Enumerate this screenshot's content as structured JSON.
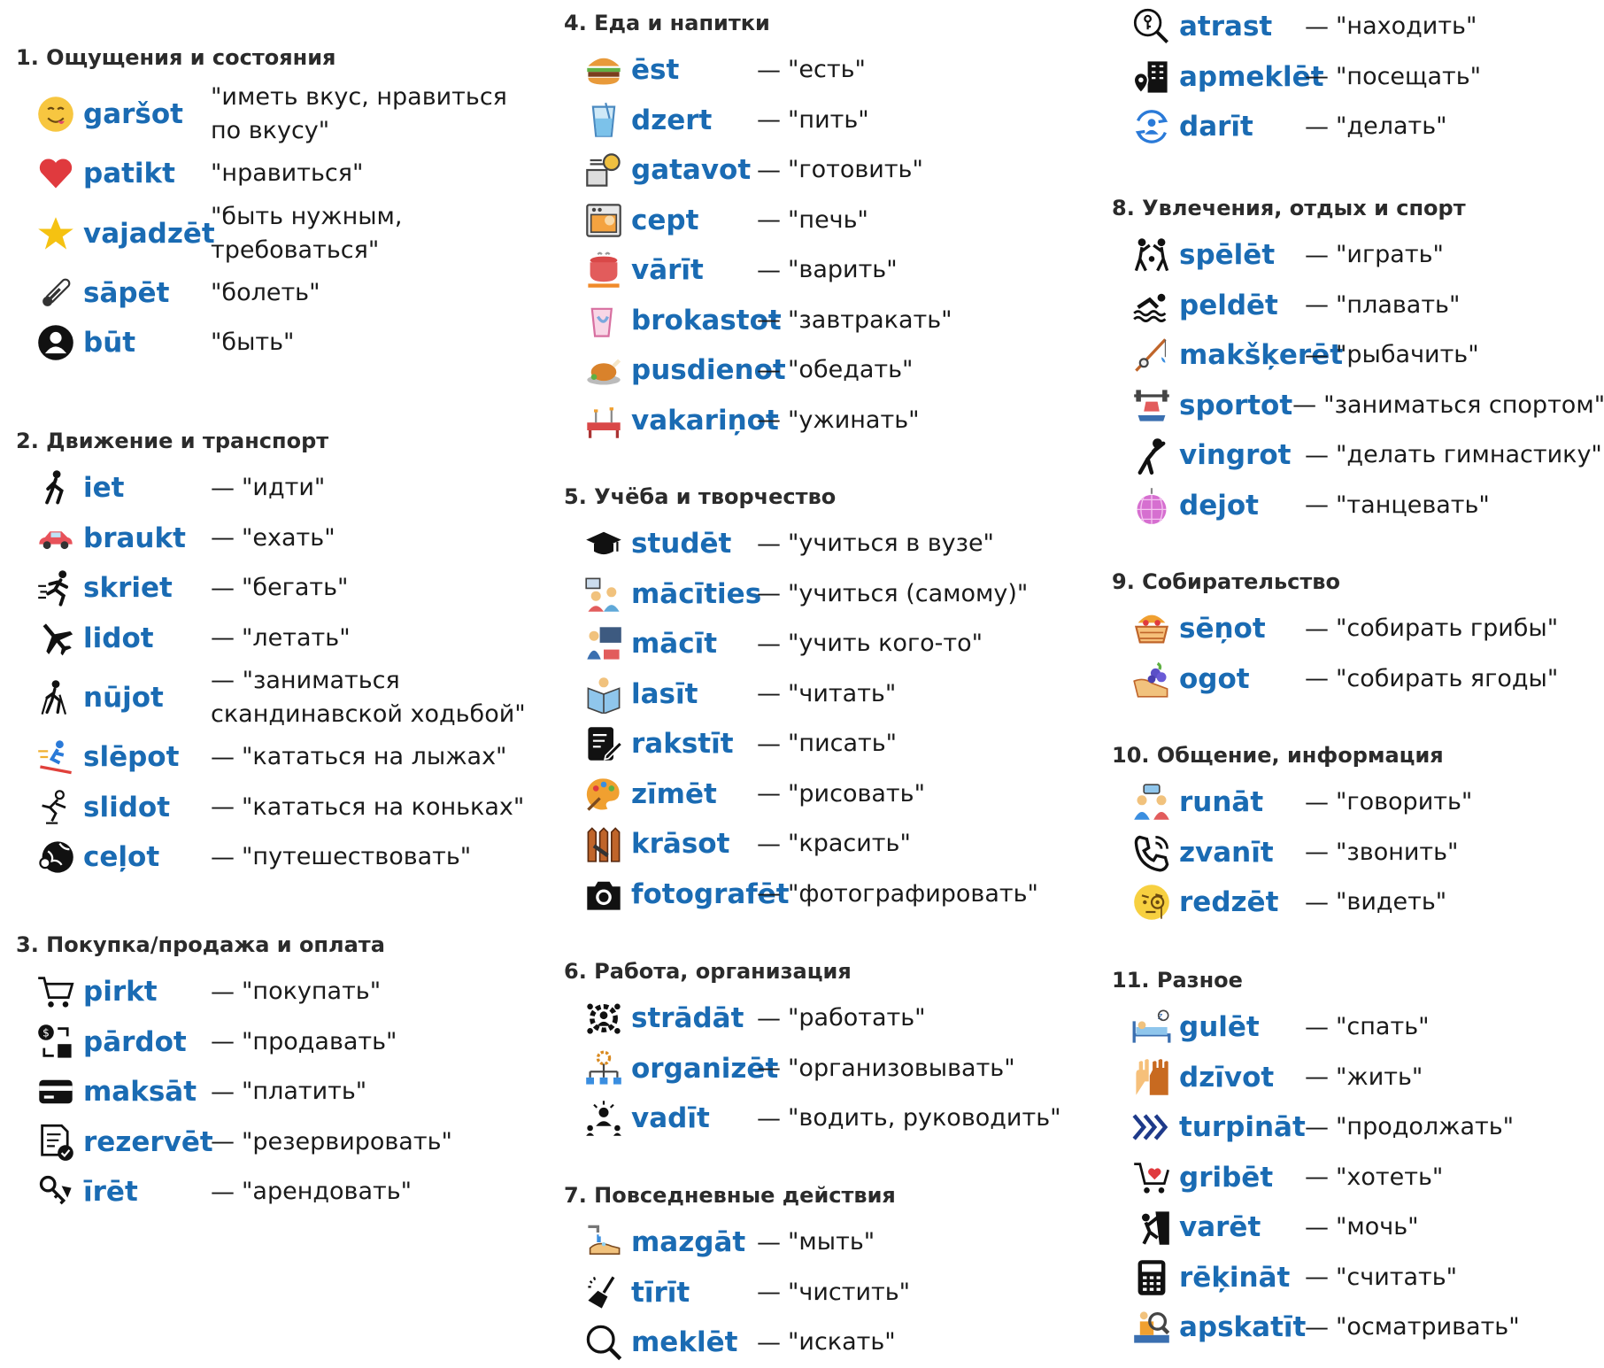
{
  "sections": [
    {
      "title": "1. Ощущения и состояния",
      "items": [
        {
          "verb": "garšot",
          "translation": "\"иметь вкус, нравиться по вкусу\"",
          "dash": "",
          "icon": "smiley-face-icon"
        },
        {
          "verb": "patikt",
          "translation": "\"нравиться\"",
          "dash": "",
          "icon": "heart-icon"
        },
        {
          "verb": "vajadzēt",
          "translation": "\"быть нужным, требоваться\"",
          "dash": "",
          "icon": "star-icon"
        },
        {
          "verb": "sāpēt",
          "translation": "\"болеть\"",
          "dash": "",
          "icon": "thermometer-icon"
        },
        {
          "verb": "būt",
          "translation": "\"быть\"",
          "dash": "",
          "icon": "person-circle-icon"
        }
      ]
    },
    {
      "title": "2. Движение и транспорт",
      "items": [
        {
          "verb": "iet",
          "translation": "\"идти\"",
          "dash": "—",
          "icon": "walking-person-icon"
        },
        {
          "verb": "braukt",
          "translation": "\"ехать\"",
          "dash": "—",
          "icon": "car-icon"
        },
        {
          "verb": "skriet",
          "translation": "\"бегать\"",
          "dash": "—",
          "icon": "running-person-icon"
        },
        {
          "verb": "lidot",
          "translation": "\"летать\"",
          "dash": "—",
          "icon": "airplane-icon"
        },
        {
          "verb": "nūjot",
          "translation": "\"заниматься скандинавской ходьбой\"",
          "dash": "—",
          "icon": "nordic-walking-icon"
        },
        {
          "verb": "slēpot",
          "translation": "\"кататься на лыжах\"",
          "dash": "—",
          "icon": "skiing-icon"
        },
        {
          "verb": "slidot",
          "translation": "\"кататься на коньках\"",
          "dash": "—",
          "icon": "skating-icon"
        },
        {
          "verb": "ceļot",
          "translation": "\"путешествовать\"",
          "dash": "—",
          "icon": "globe-traveler-icon"
        }
      ]
    },
    {
      "title": "3. Покупка/продажа и оплата",
      "items": [
        {
          "verb": "pirkt",
          "translation": "\"покупать\"",
          "dash": "—",
          "icon": "shopping-cart-icon"
        },
        {
          "verb": "pārdot",
          "translation": "\"продавать\"",
          "dash": "—",
          "icon": "sell-exchange-icon"
        },
        {
          "verb": "maksāt",
          "translation": "\"платить\"",
          "dash": "—",
          "icon": "credit-card-icon"
        },
        {
          "verb": "rezervēt",
          "translation": "\"резервировать\"",
          "dash": "—",
          "icon": "reservation-document-icon"
        },
        {
          "verb": "īrēt",
          "translation": "\"арендовать\"",
          "dash": "—",
          "icon": "rent-key-icon"
        }
      ]
    },
    {
      "title": "4. Еда и напитки",
      "items": [
        {
          "verb": "ēst",
          "translation": "\"есть\"",
          "dash": "—",
          "icon": "burger-icon"
        },
        {
          "verb": "dzert",
          "translation": "\"пить\"",
          "dash": "—",
          "icon": "glass-icon"
        },
        {
          "verb": "gatavot",
          "translation": "\"готовить\"",
          "dash": "—",
          "icon": "cooking-icon"
        },
        {
          "verb": "cept",
          "translation": "\"печь\"",
          "dash": "—",
          "icon": "oven-icon"
        },
        {
          "verb": "vārīt",
          "translation": "\"варить\"",
          "dash": "—",
          "icon": "pot-icon"
        },
        {
          "verb": "brokastot",
          "translation": "\"завтракать\"",
          "dash": "—",
          "icon": "breakfast-cup-icon"
        },
        {
          "verb": "pusdienot",
          "translation": "\"обедать\"",
          "dash": "—",
          "icon": "roast-chicken-icon"
        },
        {
          "verb": "vakariņot",
          "translation": "\"ужинать\"",
          "dash": "—",
          "icon": "dinner-table-icon"
        }
      ]
    },
    {
      "title": "5. Учёба и творчество",
      "items": [
        {
          "verb": "studēt",
          "translation": "\"учиться в вузе\"",
          "dash": "—",
          "icon": "graduation-cap-icon"
        },
        {
          "verb": "mācīties",
          "translation": "\"учиться (самому)\"",
          "dash": "—",
          "icon": "students-icon"
        },
        {
          "verb": "mācīt",
          "translation": "\"учить кого-то\"",
          "dash": "—",
          "icon": "teacher-icon"
        },
        {
          "verb": "lasīt",
          "translation": "\"читать\"",
          "dash": "—",
          "icon": "reading-book-icon"
        },
        {
          "verb": "rakstīt",
          "translation": "\"писать\"",
          "dash": "—",
          "icon": "writing-icon"
        },
        {
          "verb": "zīmēt",
          "translation": "\"рисовать\"",
          "dash": "—",
          "icon": "palette-icon"
        },
        {
          "verb": "krāsot",
          "translation": "\"красить\"",
          "dash": "—",
          "icon": "paint-fence-icon"
        },
        {
          "verb": "fotografēt",
          "translation": "\"фотографировать\"",
          "dash": "—",
          "icon": "camera-icon"
        }
      ]
    },
    {
      "title": "6. Работа, организация",
      "items": [
        {
          "verb": "strādāt",
          "translation": "\"работать\"",
          "dash": "—",
          "icon": "team-gear-icon"
        },
        {
          "verb": "organizēt",
          "translation": "\"организовывать\"",
          "dash": "—",
          "icon": "organization-icon"
        },
        {
          "verb": "vadīt",
          "translation": "\"водить, руководить\"",
          "dash": "—",
          "icon": "leader-icon"
        }
      ]
    },
    {
      "title": "7. Повседневные действия",
      "items": [
        {
          "verb": "mazgāt",
          "translation": "\"мыть\"",
          "dash": "—",
          "icon": "washing-hands-icon"
        },
        {
          "verb": "tīrīt",
          "translation": "\"чистить\"",
          "dash": "—",
          "icon": "cleaning-icon"
        },
        {
          "verb": "meklēt",
          "translation": "\"искать\"",
          "dash": "—",
          "icon": "magnifier-icon"
        },
        {
          "verb": "atrast",
          "translation": "\"находить\"",
          "dash": "—",
          "icon": "found-key-icon"
        },
        {
          "verb": "apmeklēt",
          "translation": "\"посещать\"",
          "dash": "—",
          "icon": "visit-location-icon"
        },
        {
          "verb": "darīt",
          "translation": "\"делать\"",
          "dash": "—",
          "icon": "doing-cycle-icon"
        }
      ]
    },
    {
      "title": "8. Увлечения, отдых и спорт",
      "items": [
        {
          "verb": "spēlēt",
          "translation": "\"играть\"",
          "dash": "—",
          "icon": "playing-kids-icon"
        },
        {
          "verb": "peldēt",
          "translation": "\"плавать\"",
          "dash": "—",
          "icon": "swimming-icon"
        },
        {
          "verb": "makšķerēt",
          "translation": "\"рыбачить\"",
          "dash": "—",
          "icon": "fishing-icon"
        },
        {
          "verb": "sportot",
          "translation": "\"заниматься спортом\"",
          "dash": "—",
          "icon": "sport-gear-icon"
        },
        {
          "verb": "vingrot",
          "translation": "\"делать гимнастику\"",
          "dash": "—",
          "icon": "gymnastics-icon"
        },
        {
          "verb": "dejot",
          "translation": "\"танцевать\"",
          "dash": "—",
          "icon": "disco-ball-icon"
        }
      ]
    },
    {
      "title": "9. Собирательство",
      "items": [
        {
          "verb": "sēņot",
          "translation": "\"собирать грибы\"",
          "dash": "—",
          "icon": "mushroom-basket-icon"
        },
        {
          "verb": "ogot",
          "translation": "\"собирать ягоды\"",
          "dash": "—",
          "icon": "berries-hand-icon"
        }
      ]
    },
    {
      "title": "10. Общение, информация",
      "items": [
        {
          "verb": "runāt",
          "translation": "\"говорить\"",
          "dash": "—",
          "icon": "talking-people-icon"
        },
        {
          "verb": "zvanīt",
          "translation": "\"звонить\"",
          "dash": "—",
          "icon": "phone-icon"
        },
        {
          "verb": "redzēt",
          "translation": "\"видеть\"",
          "dash": "—",
          "icon": "monocle-face-icon"
        }
      ]
    },
    {
      "title": "11. Разное",
      "items": [
        {
          "verb": "gulēt",
          "translation": "\"спать\"",
          "dash": "—",
          "icon": "sleeping-bed-icon"
        },
        {
          "verb": "dzīvot",
          "translation": "\"жить\"",
          "dash": "—",
          "icon": "raised-hands-icon"
        },
        {
          "verb": "turpināt",
          "translation": "\"продолжать\"",
          "dash": "—",
          "icon": "chevrons-right-icon"
        },
        {
          "verb": "gribēt",
          "translation": "\"хотеть\"",
          "dash": "—",
          "icon": "heart-cart-icon"
        },
        {
          "verb": "varēt",
          "translation": "\"мочь\"",
          "dash": "—",
          "icon": "climber-icon"
        },
        {
          "verb": "rēķināt",
          "translation": "\"считать\"",
          "dash": "—",
          "icon": "calculator-icon"
        },
        {
          "verb": "apskatīt",
          "translation": "\"осматривать\"",
          "dash": "—",
          "icon": "inspection-icon"
        }
      ]
    }
  ],
  "colors": {
    "verb": "#1a6bb3",
    "text": "#1a1a1a",
    "heading": "#2b2b2b"
  }
}
